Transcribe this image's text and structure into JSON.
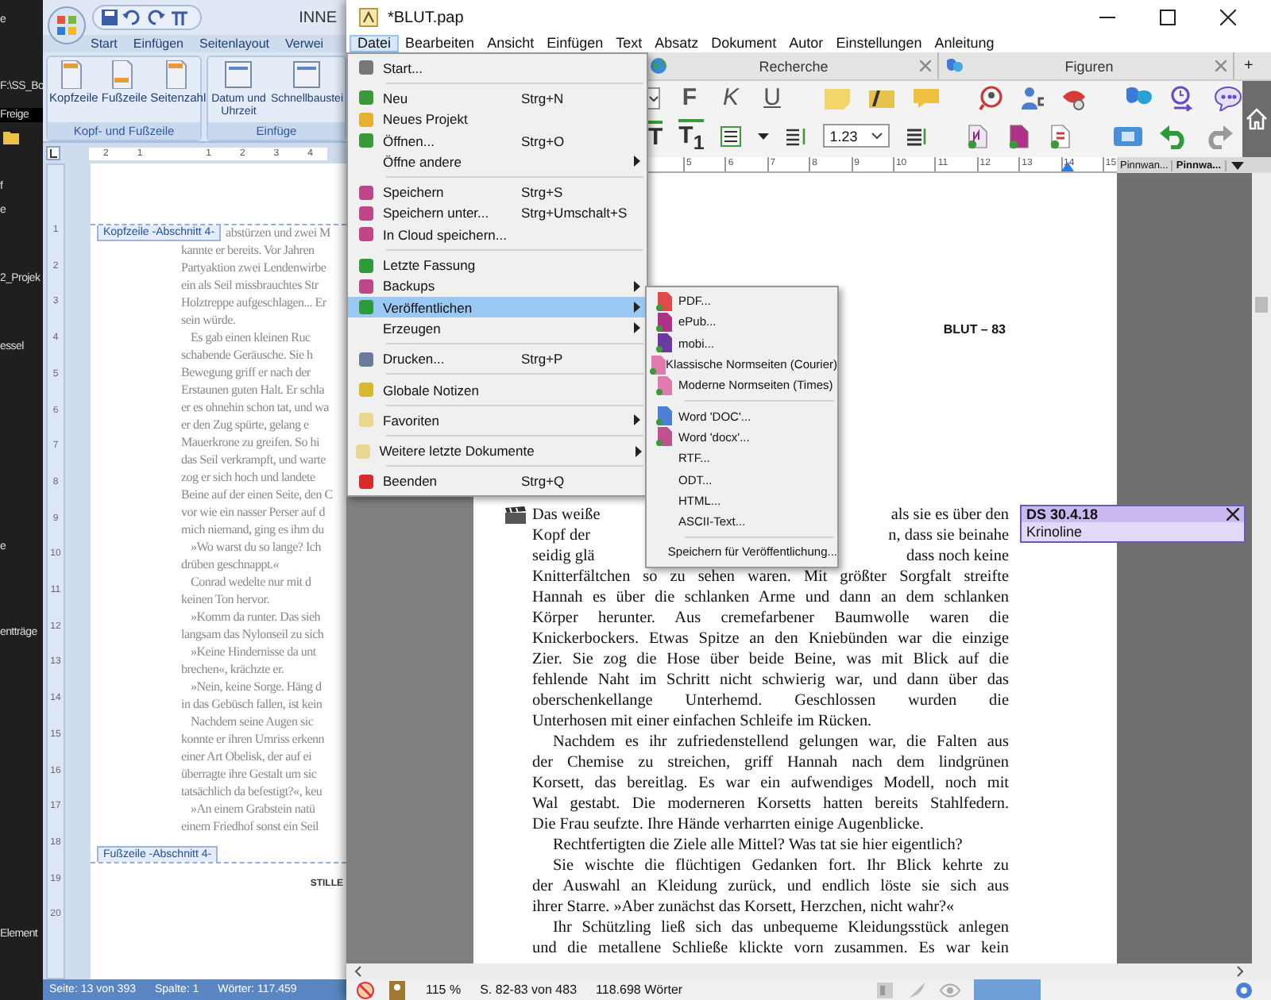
{
  "desktop": {
    "texts": [
      "e",
      "F:\\SS_Bo",
      "Freige",
      "f",
      "e",
      "2_Projek",
      "essel",
      "e",
      "entträge",
      "Element"
    ]
  },
  "word_window": {
    "title": "INNE",
    "ribbon_tabs": [
      "Start",
      "Einfügen",
      "Seitenlayout",
      "Verwei"
    ],
    "ribbon_groups": [
      {
        "label": "Kopf- und Fußzeile",
        "buttons": [
          "Kopfzeile",
          "Fußzeile",
          "Seitenzahl"
        ]
      },
      {
        "label": "Einfüge",
        "buttons": [
          "Datum und Uhrzeit",
          "Schnellbaustei"
        ]
      }
    ],
    "ruler_numbers": [
      "2",
      "1",
      "1",
      "2",
      "3",
      "4"
    ],
    "vertical_ruler_numbers": [
      "1",
      "2",
      "3",
      "4",
      "5",
      "6",
      "7",
      "8",
      "9",
      "10",
      "11",
      "12",
      "13",
      "14",
      "15",
      "16",
      "17",
      "18",
      "19",
      "20"
    ],
    "header_tag": "Kopfzeile -Abschnitt 4-",
    "body_lines": [
      {
        "text": "abstürzen und zwei M",
        "indent": false
      },
      {
        "text": "kannte er bereits. Vor Jahren",
        "indent": false
      },
      {
        "text": "Partyaktion zwei Lendenwirbe",
        "indent": false
      },
      {
        "text": "ein als Seil missbrauchtes Str",
        "indent": false
      },
      {
        "text": "Holztreppe aufgeschlagen... Er",
        "indent": false
      },
      {
        "text": "sein würde.",
        "indent": false
      },
      {
        "text": "Es gab einen kleinen Ruc",
        "indent": true
      },
      {
        "text": "schabende Geräusche. Sie h",
        "indent": false
      },
      {
        "text": "Bewegung griff er nach der",
        "indent": false
      },
      {
        "text": "Erstaunen guten Halt. Er schla",
        "indent": false
      },
      {
        "text": "er es ohnehin schon tat, und wa",
        "indent": false
      },
      {
        "text": "er den Zug spürte, gelang e",
        "indent": false
      },
      {
        "text": "Mauerkrone zu greifen. So hi",
        "indent": false
      },
      {
        "text": "das Seil verkrampft, und warte",
        "indent": false
      },
      {
        "text": "zog er sich hoch und landete",
        "indent": false
      },
      {
        "text": "Beine auf der einen Seite, den C",
        "indent": false
      },
      {
        "text": "vor wie ein nasser Perser auf d",
        "indent": false
      },
      {
        "text": "mich niemand, ging es ihm du",
        "indent": false
      },
      {
        "text": "»Wo warst du so lange? Ich",
        "indent": true
      },
      {
        "text": "drüben geschnappt.«",
        "indent": false
      },
      {
        "text": "Conrad wedelte nur mit d",
        "indent": true
      },
      {
        "text": "keinen Ton hervor.",
        "indent": false
      },
      {
        "text": "»Komm da runter. Das sieh",
        "indent": true
      },
      {
        "text": "langsam das Nylonseil zu sich",
        "indent": false
      },
      {
        "text": "»Keine Hindernisse da unt",
        "indent": true
      },
      {
        "text": "brechen«, krächzte er.",
        "indent": false
      },
      {
        "text": "»Nein, keine Sorge. Häng d",
        "indent": true
      },
      {
        "text": "in das Gebüsch fallen, ist kein",
        "indent": false
      },
      {
        "text": "Nachdem seine Augen sic",
        "indent": true
      },
      {
        "text": "konnte er ihren Umriss erkenn",
        "indent": false
      },
      {
        "text": "einer Art Obelisk, der auf ei",
        "indent": false
      },
      {
        "text": "überragte ihre Gestalt um sic",
        "indent": false
      },
      {
        "text": "tatsächlich da befestigt?«, keu",
        "indent": false
      },
      {
        "text": "»An einem Grabstein natü",
        "indent": true
      },
      {
        "text": "einem Friedhof sonst ein Seil",
        "indent": false
      }
    ],
    "footer_tag": "Fußzeile -Abschnitt 4-",
    "footer_text": "STILLE",
    "status_bar": [
      "Seite: 13 von 393",
      "Spalte: 1",
      "Wörter: 117.459"
    ]
  },
  "papyrus_window": {
    "title": "*BLUT.pap",
    "menu_bar": [
      {
        "label": "Datei",
        "selected": true
      },
      {
        "label": "Bearbeiten",
        "selected": false
      },
      {
        "label": "Ansicht",
        "selected": false
      },
      {
        "label": "Einfügen",
        "selected": false
      },
      {
        "label": "Text",
        "selected": false
      },
      {
        "label": "Absatz",
        "selected": false
      },
      {
        "label": "Dokument",
        "selected": false
      },
      {
        "label": "Autor",
        "selected": false
      },
      {
        "label": "Einstellungen",
        "selected": false
      },
      {
        "label": "Anleitung",
        "selected": false
      }
    ],
    "panel_tabs": [
      "Recherche",
      "Figuren"
    ],
    "add_tab": "+",
    "format_buttons": [
      "F",
      "K",
      "U"
    ],
    "style_buttons": [
      "T",
      "T$_{1}$"
    ],
    "line_spacing": "1.23",
    "ruler_numbers": [
      "5",
      "6",
      "7",
      "8",
      "9",
      "10",
      "11",
      "12",
      "13",
      "14",
      "15"
    ],
    "pinboard_tabs": [
      {
        "label": "Pinnwan...",
        "selected": false
      },
      {
        "label": "Pinnwa...",
        "selected": true
      }
    ],
    "page_header": "BLUT – 83",
    "text_lines": [
      {
        "kind": "split",
        "parts": [
          "Das weiße",
          "als sie es über den"
        ]
      },
      {
        "kind": "split",
        "parts": [
          "Kopf der",
          "n, dass sie beinahe"
        ]
      },
      {
        "kind": "split",
        "parts": [
          "seidig glä",
          "dass noch keine"
        ]
      },
      {
        "kind": "line",
        "text": "Knitterfältchen so zu sehen waren. Mit größter Sorgfalt streifte",
        "indent": false,
        "justify": true
      },
      {
        "kind": "line",
        "text": "Hannah es über die schlanken Arme und dann an dem schlanken",
        "indent": false,
        "justify": true
      },
      {
        "kind": "line",
        "text": "Körper herunter. Aus cremefarbener Baumwolle waren die",
        "indent": false,
        "justify": true
      },
      {
        "kind": "line",
        "text": "Knickerbockers. Etwas Spitze an den Kniebünden war die einzige",
        "indent": false,
        "justify": true
      },
      {
        "kind": "line",
        "text": "Zier. Sie zog die Hose über beide Beine, was mit Blick auf die",
        "indent": false,
        "justify": true
      },
      {
        "kind": "line",
        "text": "fehlende Naht im Schritt nicht schwierig war, und dann über das",
        "indent": false,
        "justify": true
      },
      {
        "kind": "line",
        "text": "oberschenkellange Unterhemd. Geschlossen wurden die",
        "indent": false,
        "justify": true
      },
      {
        "kind": "line",
        "text": "Unterhosen mit einer einfachen Schleife im Rücken.",
        "indent": false,
        "justify": false
      },
      {
        "kind": "line",
        "text": "Nachdem es ihr zufriedenstellend gelungen war, die Falten aus",
        "indent": true,
        "justify": true
      },
      {
        "kind": "line",
        "text": "der Chemise zu streichen, griff Hannah nach dem lindgrünen",
        "indent": false,
        "justify": true
      },
      {
        "kind": "line",
        "text": "Korsett, das bereitlag. Es war ein aufwendiges Modell, noch mit",
        "indent": false,
        "justify": true
      },
      {
        "kind": "line",
        "text": "Wal gestabt. Die moderneren Korsetts hatten bereits Stahlfedern.",
        "indent": false,
        "justify": true
      },
      {
        "kind": "line",
        "text": "Die Frau seufzte. Ihre Hände verharrten einige Augenblicke.",
        "indent": false,
        "justify": false
      },
      {
        "kind": "line",
        "text": "Rechtfertigten die Ziele alle Mittel? Was tat sie hier eigentlich?",
        "indent": true,
        "justify": false
      },
      {
        "kind": "line",
        "text": "Sie wischte die flüchtigen Gedanken fort. Ihr Blick kehrte zu",
        "indent": true,
        "justify": true
      },
      {
        "kind": "line",
        "text": "der Auswahl an Kleidung zurück, und endlich löste sie sich aus",
        "indent": false,
        "justify": true
      },
      {
        "kind": "line",
        "text": "ihrer Starre. »Aber zunächst das Korsett, Herzchen, nicht wahr?«",
        "indent": false,
        "justify": false
      },
      {
        "kind": "line",
        "text": "Ihr Schützling ließ sich das unbequeme Kleidungsstück anlegen",
        "indent": true,
        "justify": true
      },
      {
        "kind": "line",
        "text": "und die metallene Schließe klickte vorn zusammen. Es war kein",
        "indent": false,
        "justify": true
      }
    ],
    "note": {
      "title": "DS 30.4.18",
      "text": "Krinoline"
    },
    "status_bar": {
      "zoom": "115 %",
      "pages": "S. 82-83 von 483",
      "words": "118.698 Wörter"
    }
  },
  "file_menu": {
    "items": [
      {
        "kind": "item",
        "label": "Start...",
        "selected": false,
        "submenu": false
      },
      {
        "kind": "separator"
      },
      {
        "kind": "item",
        "label": "Neu",
        "shortcut": "Strg+N",
        "selected": false,
        "submenu": false
      },
      {
        "kind": "item",
        "label": "Neues Projekt",
        "selected": false,
        "submenu": false
      },
      {
        "kind": "item",
        "label": "Öffnen...",
        "shortcut": "Strg+O",
        "selected": false,
        "submenu": false
      },
      {
        "kind": "item",
        "label": "Öffne andere",
        "selected": false,
        "submenu": true
      },
      {
        "kind": "separator"
      },
      {
        "kind": "item",
        "label": "Speichern",
        "shortcut": "Strg+S",
        "selected": false,
        "submenu": false
      },
      {
        "kind": "item",
        "label": "Speichern unter...",
        "shortcut": "Strg+Umschalt+S",
        "selected": false,
        "submenu": false
      },
      {
        "kind": "item",
        "label": "In Cloud speichern...",
        "selected": false,
        "submenu": false
      },
      {
        "kind": "separator"
      },
      {
        "kind": "item",
        "label": "Letzte Fassung",
        "selected": false,
        "submenu": false
      },
      {
        "kind": "item",
        "label": "Backups",
        "selected": false,
        "submenu": true
      },
      {
        "kind": "item",
        "label": "Veröffentlichen",
        "selected": true,
        "submenu": true
      },
      {
        "kind": "item",
        "label": "Erzeugen",
        "selected": false,
        "submenu": true
      },
      {
        "kind": "separator"
      },
      {
        "kind": "item",
        "label": "Drucken...",
        "shortcut": "Strg+P",
        "selected": false,
        "submenu": false
      },
      {
        "kind": "separator"
      },
      {
        "kind": "item",
        "label": "Globale Notizen",
        "selected": false,
        "submenu": false
      },
      {
        "kind": "separator"
      },
      {
        "kind": "item",
        "label": "Favoriten",
        "selected": false,
        "submenu": true
      },
      {
        "kind": "separator"
      },
      {
        "kind": "item",
        "label": "Weitere letzte Dokumente",
        "selected": false,
        "submenu": true
      },
      {
        "kind": "separator"
      },
      {
        "kind": "item",
        "label": "Beenden",
        "shortcut": "Strg+Q",
        "selected": false,
        "submenu": false
      }
    ]
  },
  "publish_submenu": {
    "items": [
      {
        "kind": "item",
        "label": "PDF..."
      },
      {
        "kind": "item",
        "label": "ePub..."
      },
      {
        "kind": "item",
        "label": "mobi..."
      },
      {
        "kind": "item",
        "label": "Klassische Normseiten (Courier)"
      },
      {
        "kind": "item",
        "label": "Moderne Normseiten (Times)"
      },
      {
        "kind": "separator"
      },
      {
        "kind": "item",
        "label": "Word 'DOC'..."
      },
      {
        "kind": "item",
        "label": "Word 'docx'..."
      },
      {
        "kind": "item",
        "label": "RTF..."
      },
      {
        "kind": "item",
        "label": "ODT..."
      },
      {
        "kind": "item",
        "label": "HTML..."
      },
      {
        "kind": "item",
        "label": "ASCII-Text..."
      },
      {
        "kind": "separator"
      },
      {
        "kind": "item",
        "label": "Speichern für Veröffentlichung..."
      }
    ]
  }
}
